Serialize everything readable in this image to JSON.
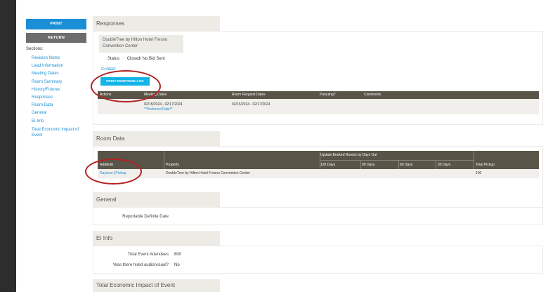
{
  "sidebar": {
    "print_label": "PRINT",
    "return_label": "RETURN",
    "sections_label": "Sections:",
    "nav": [
      "Revision Notes",
      "Lead Information",
      "Meeting Dates",
      "Room Summary",
      "History/Futures",
      "Responses",
      "Room Data",
      "General",
      "EI Info",
      "Total Economic Impact of Event"
    ]
  },
  "responses": {
    "title": "Responses",
    "hotel_line1": "DoubleTree by Hilton Hotel Fresno",
    "hotel_line2": "Convention Center",
    "status_label": "Status",
    "status_value": "Closed/ No Bid Sent",
    "contact_label": "Contact",
    "print_log_label": "PRINT RESPONSE LOG",
    "table": {
      "headers": [
        "Actions",
        "Meeting Dates",
        "Room Request Dates",
        "Pursuing?",
        "Comments"
      ],
      "row": {
        "meeting_dates": "02/15/2024 - 02/17/2024",
        "preferred": "**Preferred Date**",
        "room_request_dates": "02/15/2024 - 02/17/2024"
      }
    }
  },
  "room_data": {
    "title": "Room Data",
    "group_header": "Update Booked Rooms by Days Out",
    "headers": [
      "Add/Edit",
      "Property",
      "120 Days",
      "90 Days",
      "60 Days",
      "30 Days",
      "Total Pickup"
    ],
    "row": {
      "daysout": "Daysout",
      "sep": " | ",
      "pickup": "Pickup",
      "property": "DoubleTree by Hilton Hotel Fresno Convention Center",
      "total_pickup": "100"
    }
  },
  "general": {
    "title": "General",
    "reportable_label": "Reportable Definite Date"
  },
  "ei_info": {
    "title": "EI Info",
    "attendees_label": "Total Event Attendees",
    "attendees_value": "800",
    "audio_label": "Was there hired audio/visual?",
    "audio_value": "No"
  },
  "economic": {
    "title": "Total Economic Impact of Event"
  },
  "colors": {
    "accent_blue": "#1a8fd6",
    "log_button": "#13b5e6",
    "table_header": "#595448",
    "annotation": "#b22222"
  }
}
